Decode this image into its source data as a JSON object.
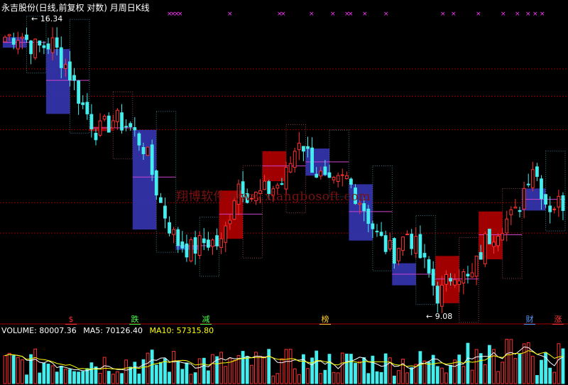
{
  "header": {
    "title": "永吉股份(日线,前复权 对数) 月周日K线"
  },
  "watermark": "翔博软件 www.xiangbosoft.com",
  "price_labels": {
    "high": "16.34",
    "low": "9.08"
  },
  "signal_markers": [
    {
      "label": "$",
      "color": "#ff3333"
    },
    {
      "label": "跌",
      "color": "#44ff44"
    },
    {
      "label": "减",
      "color": "#44ff44"
    },
    {
      "label": "榜",
      "color": "#ffcc33"
    },
    {
      "label": "财",
      "color": "#5599ff"
    },
    {
      "label": "涨",
      "color": "#ff3333"
    }
  ],
  "volume_legend": {
    "volume": "VOLUME: 80007.36",
    "ma5": "MA5: 70126.40",
    "ma10": "MA10: 57315.80"
  },
  "colors": {
    "up": "#ff3333",
    "down": "#44eeee",
    "up_box": "#aa0000",
    "down_box": "#3333aa",
    "grid": "#8b0000",
    "ma5": "#ffffff",
    "ma10": "#ffff00",
    "star": "#ff33ff"
  },
  "chart_data": [
    {
      "type": "candlestick",
      "title": "永吉股份 日线",
      "y_scale": "log",
      "ylim": [
        8.9,
        17.0
      ],
      "annotated_high": 16.34,
      "annotated_low": 9.08,
      "waypoints": [
        16.2,
        16.3,
        15.8,
        16.0,
        15.2,
        14.0,
        13.2,
        13.6,
        13.4,
        12.8,
        11.4,
        10.5,
        10.3,
        10.5,
        10.4,
        11.9,
        11.5,
        11.7,
        11.9,
        13.1,
        12.2,
        11.7,
        12.0,
        11.4,
        10.6,
        10.2,
        10.7,
        10.0,
        9.3,
        9.9,
        9.6,
        10.5,
        10.9,
        11.1,
        12.4,
        11.3,
        11.4
      ]
    },
    {
      "type": "bar",
      "title": "VOLUME",
      "series": [
        {
          "name": "VOLUME",
          "last": 80007.36
        },
        {
          "name": "MA5",
          "last": 70126.4
        },
        {
          "name": "MA10",
          "last": 57315.8
        }
      ]
    }
  ]
}
